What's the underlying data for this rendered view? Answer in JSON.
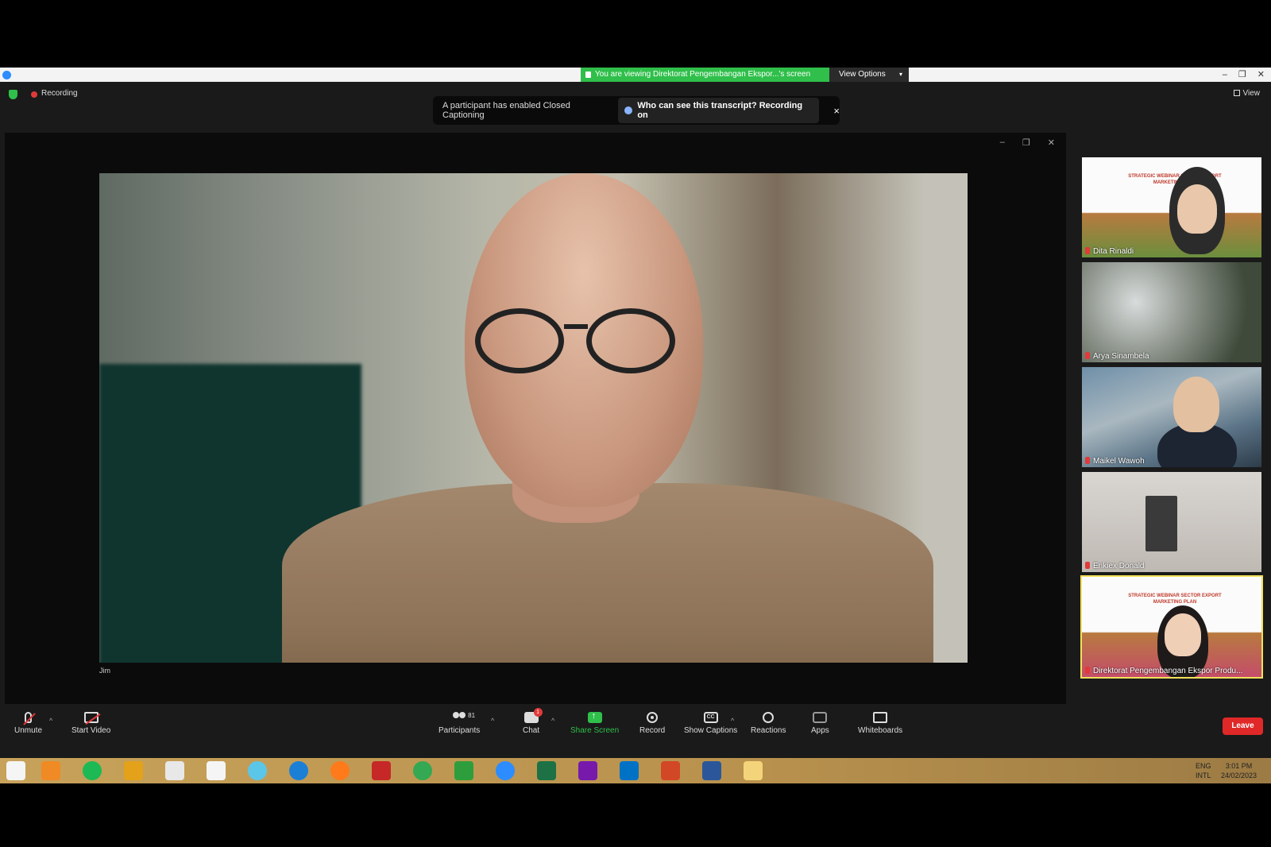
{
  "titlebar": {
    "viewing_banner": "You are viewing Direktorat Pengembangan Ekspor...'s screen",
    "view_options": "View Options",
    "window_controls": [
      "–",
      "❐",
      "✕"
    ]
  },
  "meeting": {
    "recording_label": "Recording",
    "view_label": "View"
  },
  "caption_notice": {
    "message": "A participant has enabled Closed Captioning",
    "who_link": "Who can see this transcript? Recording on",
    "close": "×"
  },
  "share_window": {
    "controls": [
      "–",
      "❐",
      "✕"
    ],
    "speaker_name": "Jim"
  },
  "participants": [
    {
      "name": "Dita Rinaldi"
    },
    {
      "name": "Arya Sinambela"
    },
    {
      "name": "Maikel Wawoh"
    },
    {
      "name": "Enkiex Donald"
    },
    {
      "name": "Direktorat Pengembangan Ekspor Produ..."
    }
  ],
  "slide_text": "STRATEGIC WEBINAR SECTOR EXPORT MARKETING PLAN",
  "toolbar": {
    "unmute": "Unmute",
    "start_video": "Start Video",
    "participants": "Participants",
    "participants_count": "81",
    "chat": "Chat",
    "chat_badge": "1",
    "share_screen": "Share Screen",
    "record": "Record",
    "show_captions": "Show Captions",
    "reactions": "Reactions",
    "apps": "Apps",
    "whiteboards": "Whiteboards",
    "leave": "Leave"
  },
  "taskbar": {
    "lang_top": "ENG",
    "lang_bottom": "INTL",
    "time": "3:01 PM",
    "date": "24/02/2023"
  },
  "colors": {
    "zoom_green": "#2fbf4a",
    "leave_red": "#e02828",
    "active_speaker": "#f1e15a"
  }
}
